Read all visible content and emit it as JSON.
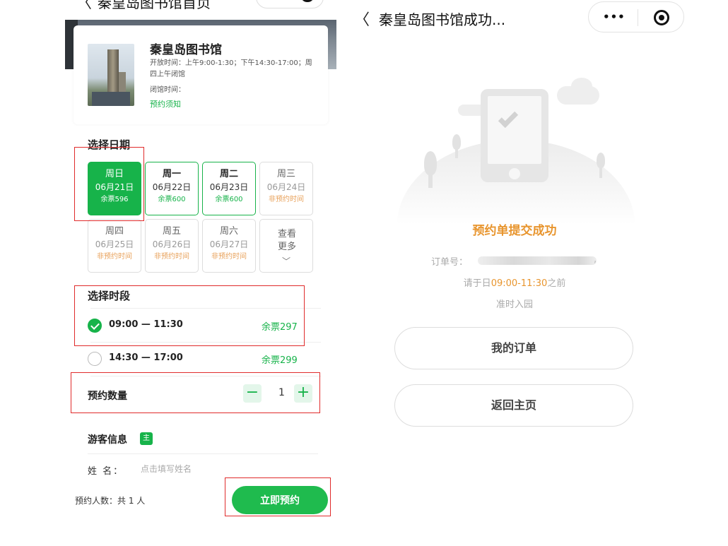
{
  "left": {
    "nav": {
      "back": "〈",
      "title": "秦皇岛图书馆首页",
      "more": "•••"
    },
    "library": {
      "name": "秦皇岛图书馆",
      "open_hours": "开放时间：上午9:00-1:30；下午14:30-17:00；周四上午闭馆",
      "close_time": "闭馆时间：",
      "notice_link": "预约须知"
    },
    "date_section": {
      "title": "选择日期",
      "days": [
        {
          "week": "周日",
          "date": "06月21日",
          "remain": "余票596",
          "state": "selected"
        },
        {
          "week": "周一",
          "date": "06月22日",
          "remain": "余票600",
          "state": "available"
        },
        {
          "week": "周二",
          "date": "06月23日",
          "remain": "余票600",
          "state": "available"
        },
        {
          "week": "周三",
          "date": "06月24日",
          "remain": "非预约时间",
          "state": "unavailable"
        },
        {
          "week": "周四",
          "date": "06月25日",
          "remain": "非预约时间",
          "state": "unavailable"
        },
        {
          "week": "周五",
          "date": "06月26日",
          "remain": "非预约时间",
          "state": "unavailable"
        },
        {
          "week": "周六",
          "date": "06月27日",
          "remain": "非预约时间",
          "state": "unavailable"
        }
      ],
      "more_label": "查看更多",
      "more_icon": "chevron-down-icon"
    },
    "time_section": {
      "title": "选择时段",
      "slots": [
        {
          "time": "09:00 — 11:30",
          "remain": "余票297",
          "selected": true
        },
        {
          "time": "14:30 — 17:00",
          "remain": "余票299",
          "selected": false
        }
      ]
    },
    "quantity": {
      "label": "预约数量",
      "minus": "−",
      "value": "1",
      "plus": "+"
    },
    "guest": {
      "title": "游客信息",
      "main_tag": "主",
      "name_label": "姓  名：",
      "name_placeholder": "点击填写姓名"
    },
    "bottom": {
      "count_text": "预约人数：共 1 人",
      "book_button": "立即预约"
    }
  },
  "right": {
    "nav": {
      "back": "〈",
      "title": "秦皇岛图书馆成功...",
      "more": "•••"
    },
    "success_title": "预约单提交成功",
    "order_label": "订单号：",
    "arrive_prefix": "请于日",
    "arrive_time": "09:00-11:30",
    "arrive_suffix": "之前",
    "enter_text": "准时入园",
    "my_orders_button": "我的订单",
    "home_button": "返回主页"
  },
  "colors": {
    "accent": "#17b34a",
    "warning": "#e8952e",
    "highlight": "#e02b2b"
  }
}
